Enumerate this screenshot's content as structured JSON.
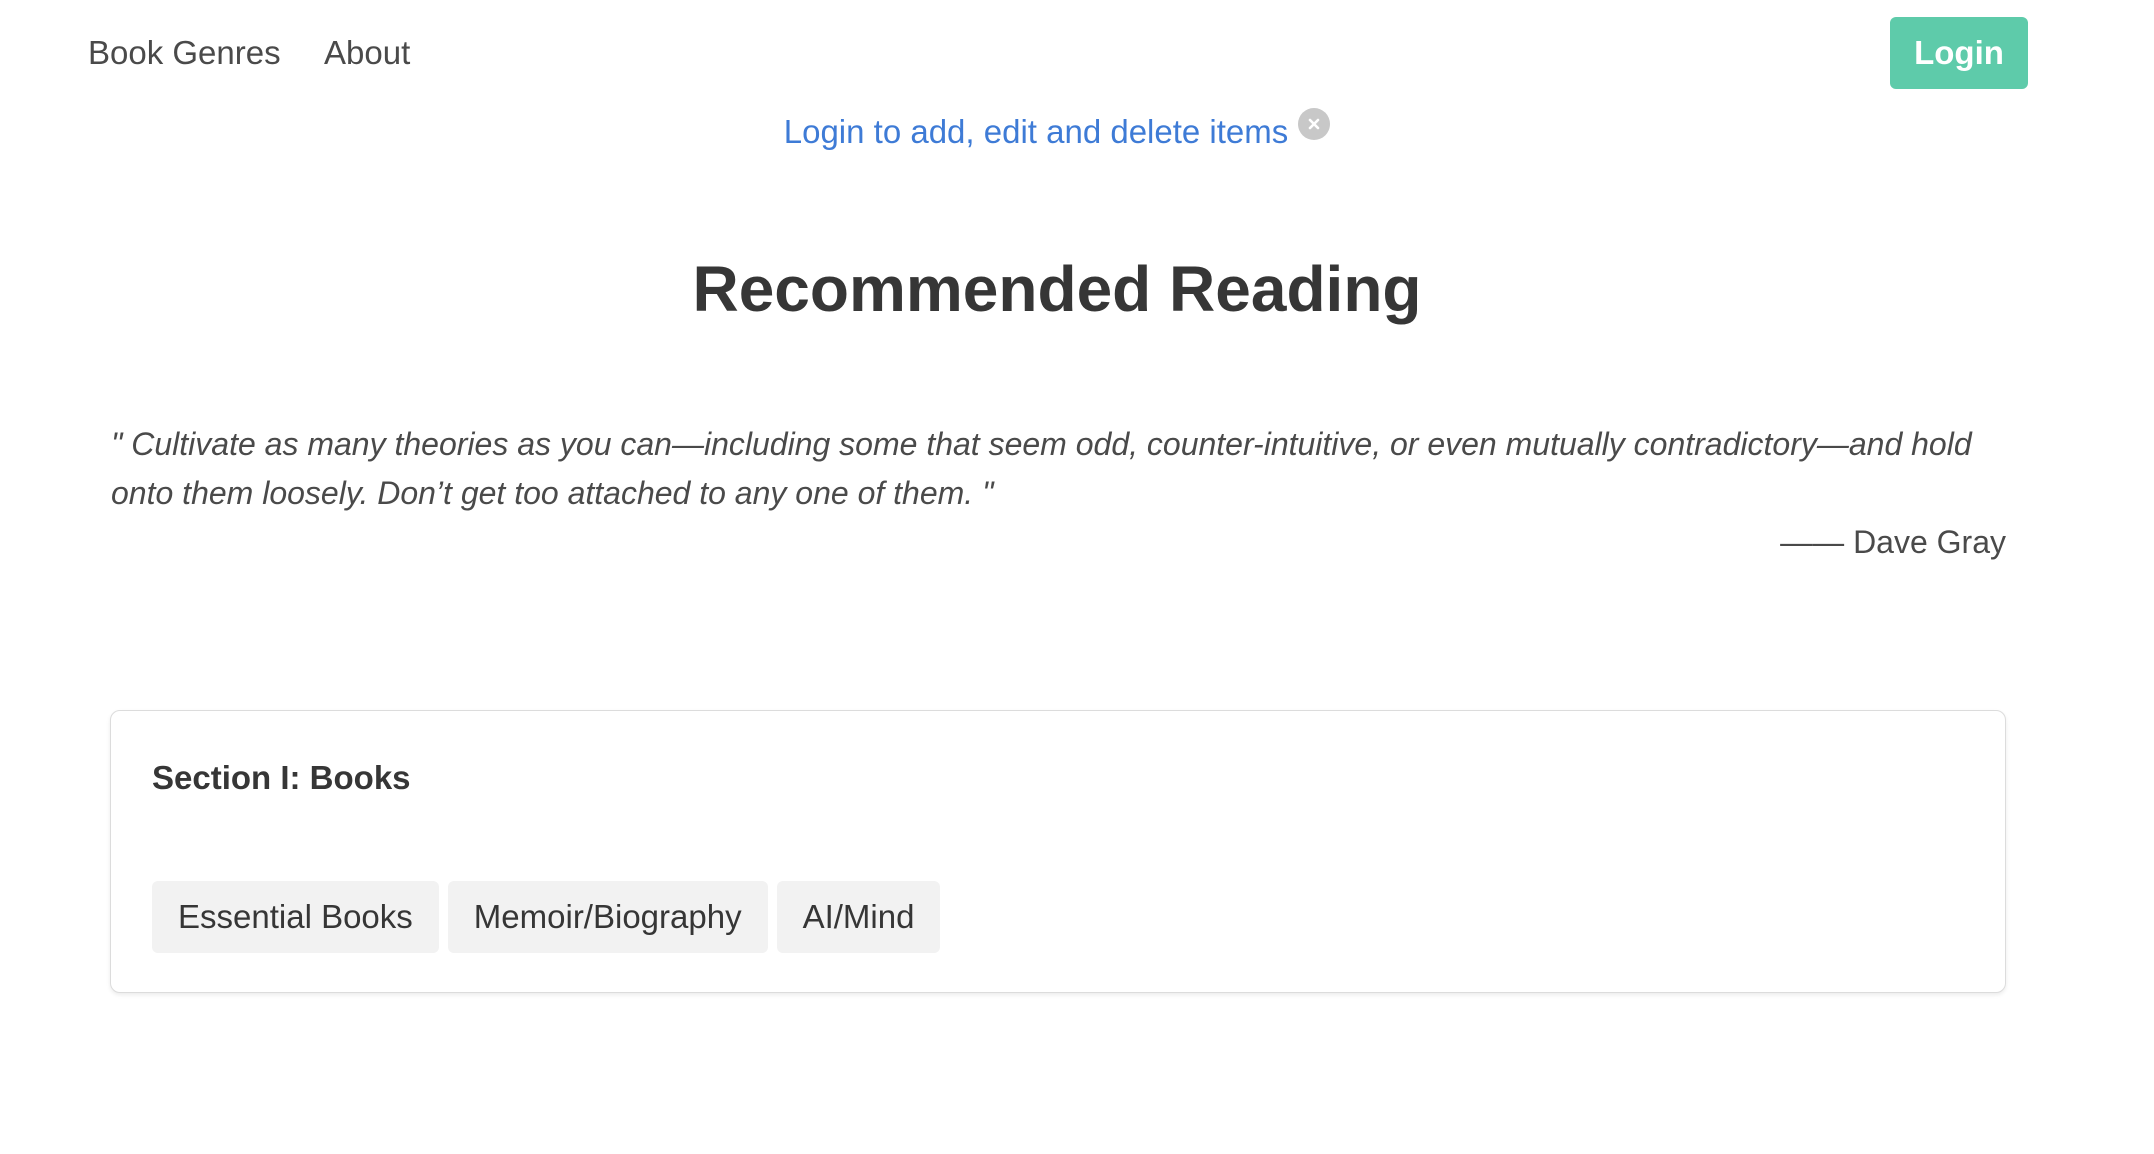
{
  "nav": {
    "items": [
      {
        "label": "Book Genres"
      },
      {
        "label": "About"
      }
    ],
    "login_label": "Login"
  },
  "notice": {
    "text": "Login to add, edit and delete items",
    "close_icon": "close-circle-icon"
  },
  "main": {
    "title": "Recommended Reading",
    "quote": {
      "text": "\" Cultivate as many theories as you can—including some that seem odd, counter-intuitive, or even mutually contradictory—and hold onto them loosely. Don’t get too attached to any one of them. \"",
      "author": "—— Dave Gray"
    },
    "section": {
      "title": "Section I: Books",
      "tags": [
        {
          "label": "Essential Books"
        },
        {
          "label": "Memoir/Biography"
        },
        {
          "label": "AI/Mind"
        }
      ]
    }
  },
  "colors": {
    "accent": "#5ecbaa",
    "link": "#3e7bd6",
    "text": "#363636",
    "tag_bg": "#f2f2f2"
  }
}
